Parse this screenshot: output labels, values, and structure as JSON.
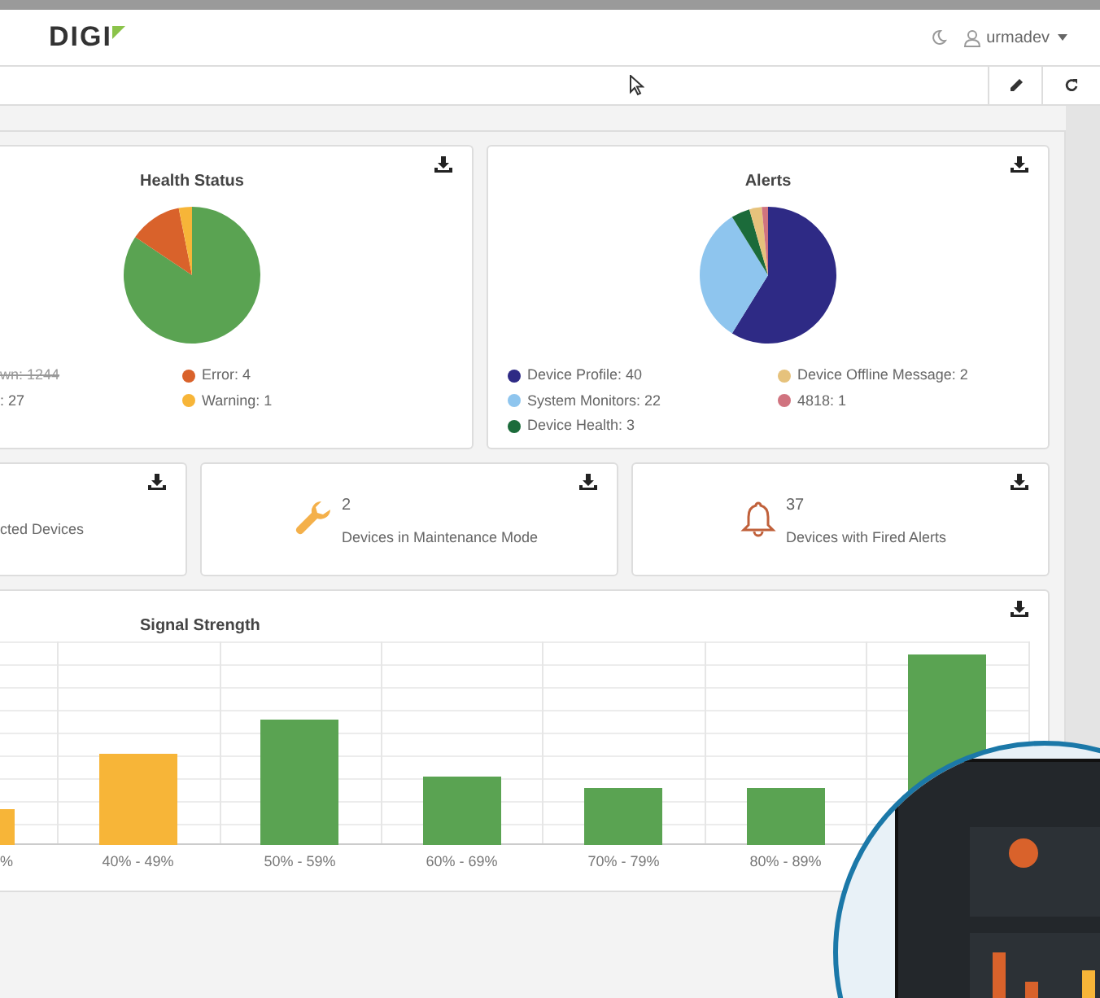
{
  "header": {
    "logo": "DIGI",
    "user": "urmadev"
  },
  "health": {
    "title": "Health Status",
    "toggled_legend": [
      {
        "label": "wn: 1244",
        "struck": true
      }
    ],
    "chart_data": {
      "type": "pie",
      "categories": [
        ": 27",
        "Error: 4",
        "Warning: 1"
      ],
      "values": [
        27,
        4,
        1
      ],
      "colors": [
        "#5aa352",
        "#d9622b",
        "#f7b538"
      ]
    }
  },
  "alerts": {
    "title": "Alerts",
    "chart_data": {
      "type": "pie",
      "categories": [
        "Device Profile: 40",
        "System Monitors: 22",
        "Device Health: 3",
        "Device Offline Message: 2",
        "4818: 1"
      ],
      "values": [
        40,
        22,
        3,
        2,
        1
      ],
      "colors": [
        "#2e2a85",
        "#8ec5ee",
        "#1b6b3a",
        "#e6c27c",
        "#d0737f"
      ]
    }
  },
  "stats": [
    {
      "kind": "cut",
      "label": "cted Devices"
    },
    {
      "kind": "maintenance",
      "count": "2",
      "label": "Devices in Maintenance Mode"
    },
    {
      "kind": "alerts",
      "count": "37",
      "label": "Devices with Fired Alerts"
    }
  ],
  "signal": {
    "title": "Signal Strength",
    "x_labels": [
      "%",
      "40% - 49%",
      "50% - 59%",
      "60% - 69%",
      "70% - 79%",
      "80% - 89%"
    ]
  }
}
